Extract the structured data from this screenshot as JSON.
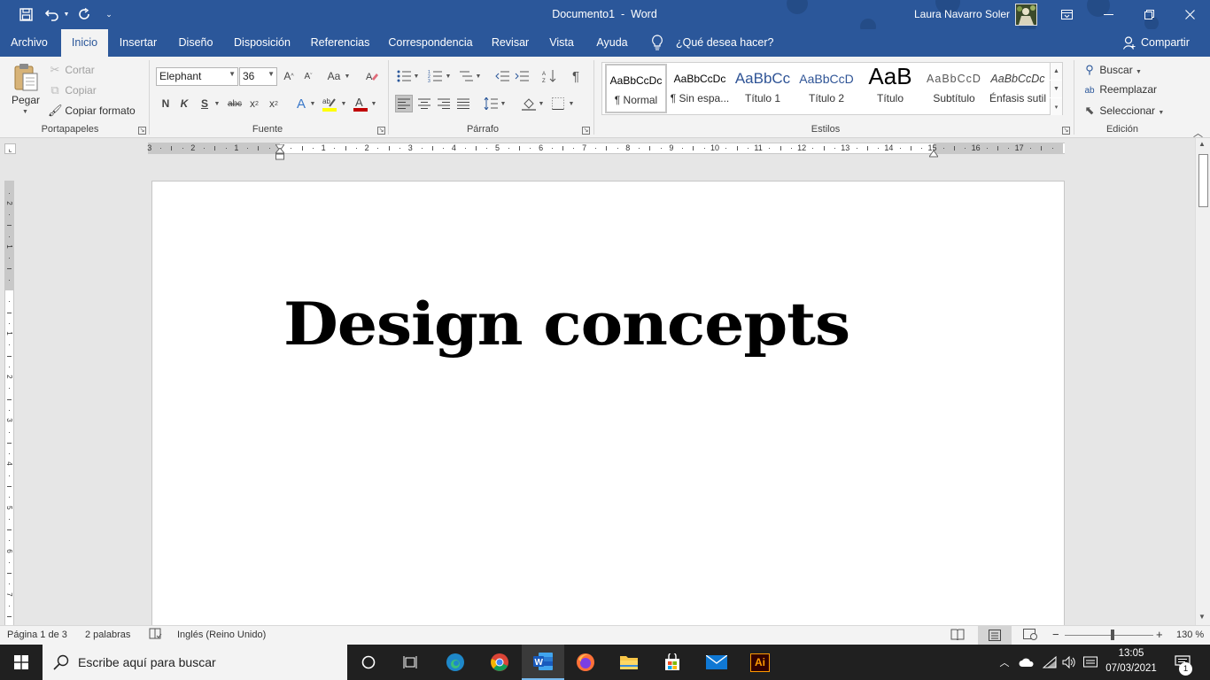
{
  "titlebar": {
    "doc_title": "Documento1",
    "separator": "-",
    "app_name": "Word",
    "user_name": "Laura Navarro Soler",
    "save_icon": "save-icon",
    "undo_icon": "undo-icon",
    "redo_icon": "redo-icon"
  },
  "tabs": {
    "archivo": "Archivo",
    "inicio": "Inicio",
    "insertar": "Insertar",
    "diseno": "Diseño",
    "disposicion": "Disposición",
    "referencias": "Referencias",
    "correspondencia": "Correspondencia",
    "revisar": "Revisar",
    "vista": "Vista",
    "ayuda": "Ayuda",
    "tell_me": "¿Qué desea hacer?",
    "share": "Compartir"
  },
  "ribbon": {
    "clipboard": {
      "paste": "Pegar",
      "cut": "Cortar",
      "copy": "Copiar",
      "format_painter": "Copiar formato",
      "group": "Portapapeles"
    },
    "font": {
      "family": "Elephant",
      "size": "36",
      "bold": "N",
      "italic": "K",
      "underline": "S",
      "strike": "abc",
      "group": "Fuente",
      "case_label": "Aa",
      "font_color": "#c00000",
      "highlight_color": "#ffff00"
    },
    "paragraph": {
      "group": "Párrafo"
    },
    "styles": {
      "group": "Estilos",
      "items": [
        {
          "preview": "AaBbCcDc",
          "name": "¶ Normal"
        },
        {
          "preview": "AaBbCcDc",
          "name": "¶ Sin espa..."
        },
        {
          "preview": "AaBbCc",
          "name": "Título 1"
        },
        {
          "preview": "AaBbCcD",
          "name": "Título 2"
        },
        {
          "preview": "AaB",
          "name": "Título"
        },
        {
          "preview": "AaBbCcD",
          "name": "Subtítulo"
        },
        {
          "preview": "AaBbCcDc",
          "name": "Énfasis sutil"
        }
      ]
    },
    "editing": {
      "find": "Buscar",
      "replace": "Reemplazar",
      "select": "Seleccionar",
      "group": "Edición"
    }
  },
  "ruler": {
    "h_numbers": [
      "3",
      "2",
      "1",
      "1",
      "2",
      "3",
      "4",
      "5",
      "6",
      "7",
      "8",
      "9",
      "10",
      "11",
      "12",
      "13",
      "14",
      "15",
      "16",
      "17"
    ],
    "v_numbers": [
      "2",
      "1",
      "1",
      "2",
      "3",
      "4",
      "5",
      "6",
      "7"
    ]
  },
  "document": {
    "heading": "Design concepts"
  },
  "statusbar": {
    "page": "Página 1 de 3",
    "words": "2 palabras",
    "language": "Inglés (Reino Unido)",
    "zoom": "130 %",
    "zoom_level": 1.3,
    "zoom_minus": "−",
    "zoom_plus": "+"
  },
  "taskbar": {
    "search_placeholder": "Escribe aquí para buscar",
    "time": "13:05",
    "date": "07/03/2021",
    "notification_count": "1",
    "ai_label": "Ai"
  }
}
